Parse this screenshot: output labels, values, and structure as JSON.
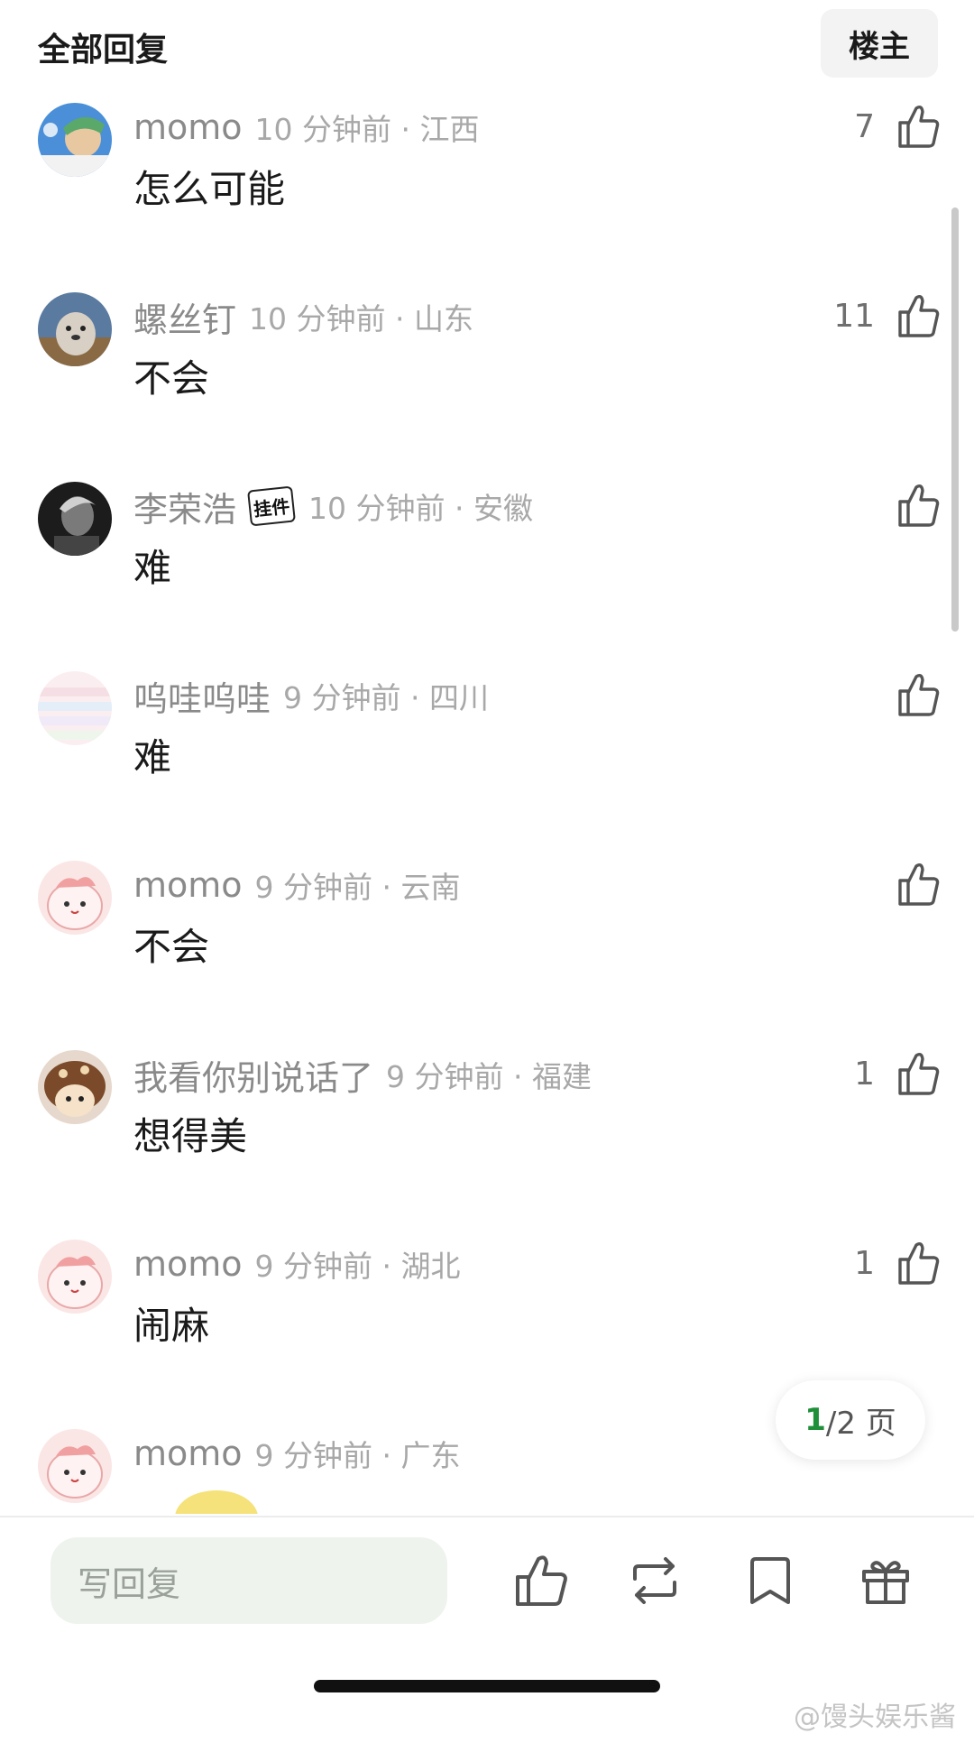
{
  "header": {
    "title": "全部回复",
    "op_toggle_label": "楼主"
  },
  "comments": [
    {
      "username": "momo",
      "time": "10 分钟前 · 江西",
      "content": "怎么可能",
      "likes": "7"
    },
    {
      "username": "螺丝钉",
      "time": "10 分钟前 · 山东",
      "content": "不会",
      "likes": "11"
    },
    {
      "username": "李荣浩",
      "pendant": "挂件",
      "time": "10 分钟前 · 安徽",
      "content": "难",
      "likes": ""
    },
    {
      "username": "呜哇呜哇",
      "time": "9 分钟前 · 四川",
      "content": "难",
      "likes": ""
    },
    {
      "username": "momo",
      "time": "9 分钟前 · 云南",
      "content": "不会",
      "likes": ""
    },
    {
      "username": "我看你别说话了",
      "time": "9 分钟前 · 福建",
      "content": "想得美",
      "likes": "1"
    },
    {
      "username": "momo",
      "time": "9 分钟前 · 湖北",
      "content": "闹麻",
      "likes": "1"
    },
    {
      "username": "momo",
      "time": "9 分钟前 · 广东",
      "content": "",
      "likes": ""
    }
  ],
  "pager": {
    "current": "1",
    "total_text": "/2 页"
  },
  "toolbar": {
    "reply_placeholder": "写回复",
    "icons": [
      "thumbs-up-icon",
      "repost-icon",
      "bookmark-icon",
      "gift-icon"
    ]
  },
  "watermark": "@馒头娱乐酱",
  "colors": {
    "accent": "#1f8f3a",
    "meta_gray": "#a8a8a8",
    "input_bg": "#eef3ee"
  }
}
